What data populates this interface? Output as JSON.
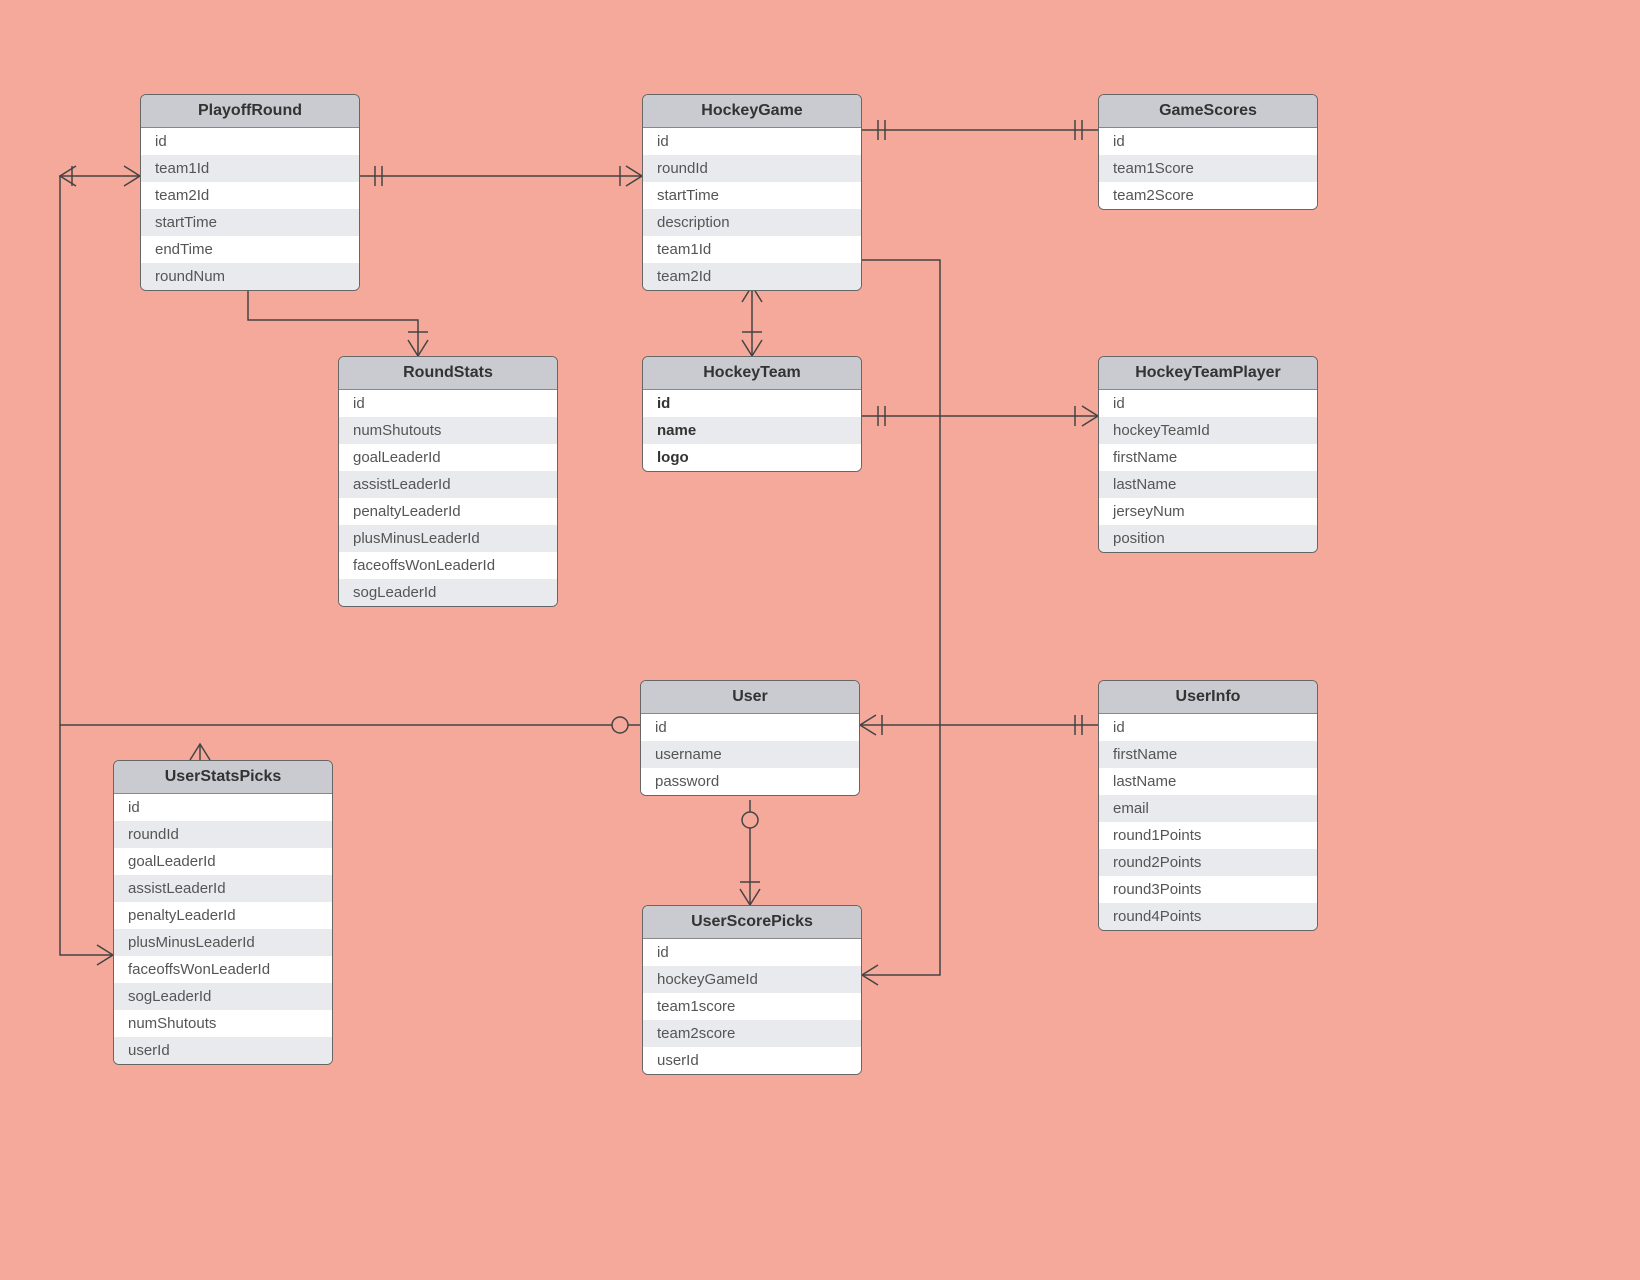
{
  "entities": {
    "playoffRound": {
      "title": "PlayoffRound",
      "fields": [
        "id",
        "team1Id",
        "team2Id",
        "startTime",
        "endTime",
        "roundNum"
      ]
    },
    "hockeyGame": {
      "title": "HockeyGame",
      "fields": [
        "id",
        "roundId",
        "startTime",
        "description",
        "team1Id",
        "team2Id"
      ]
    },
    "gameScores": {
      "title": "GameScores",
      "fields": [
        "id",
        "team1Score",
        "team2Score"
      ]
    },
    "roundStats": {
      "title": "RoundStats",
      "fields": [
        "id",
        "numShutouts",
        "goalLeaderId",
        "assistLeaderId",
        "penaltyLeaderId",
        "plusMinusLeaderId",
        "faceoffsWonLeaderId",
        "sogLeaderId"
      ]
    },
    "hockeyTeam": {
      "title": "HockeyTeam",
      "fields": [
        "id",
        "name",
        "logo"
      ],
      "bold": true
    },
    "hockeyTeamPlayer": {
      "title": "HockeyTeamPlayer",
      "fields": [
        "id",
        "hockeyTeamId",
        "firstName",
        "lastName",
        "jerseyNum",
        "position"
      ]
    },
    "user": {
      "title": "User",
      "fields": [
        "id",
        "username",
        "password"
      ]
    },
    "userInfo": {
      "title": "UserInfo",
      "fields": [
        "id",
        "firstName",
        "lastName",
        "email",
        "round1Points",
        "round2Points",
        "round3Points",
        "round4Points"
      ]
    },
    "userStatsPicks": {
      "title": "UserStatsPicks",
      "fields": [
        "id",
        "roundId",
        "goalLeaderId",
        "assistLeaderId",
        "penaltyLeaderId",
        "plusMinusLeaderId",
        "faceoffsWonLeaderId",
        "sogLeaderId",
        "numShutouts",
        "userId"
      ]
    },
    "userScorePicks": {
      "title": "UserScorePicks",
      "fields": [
        "id",
        "hockeyGameId",
        "team1score",
        "team2score",
        "userId"
      ]
    }
  }
}
